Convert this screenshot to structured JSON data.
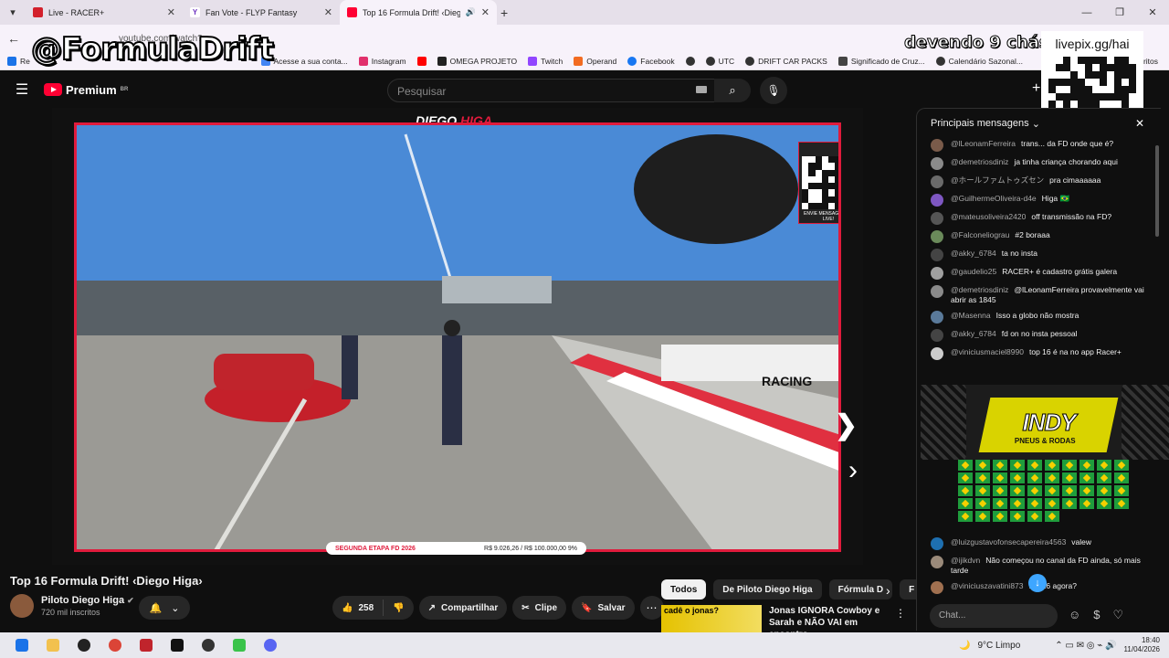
{
  "browser": {
    "tabs": [
      {
        "title": "Live - RACER+",
        "fav_color": "#d3202c",
        "active": false
      },
      {
        "title": "Fan Vote - FLYP Fantasy",
        "fav_color": "#6b2fbf",
        "active": false
      },
      {
        "title": "Top 16 Formula Drift! ‹Dieg",
        "fav_color": "#ff0033",
        "active": true
      }
    ],
    "url": "youtube.com/watch?v=...",
    "bookmarks": [
      {
        "label": "Re",
        "color": "#1a73e8"
      },
      {
        "label": "Acesse a sua conta...",
        "color": "#4285f4"
      },
      {
        "label": "Instagram",
        "color": "#e1306c"
      },
      {
        "label": "",
        "color": "#ff0000"
      },
      {
        "label": "OMEGA PROJETO",
        "color": "#222"
      },
      {
        "label": "Twitch",
        "color": "#9146ff"
      },
      {
        "label": "Operand",
        "color": "#f26b21"
      },
      {
        "label": "Facebook",
        "color": "#1877f2"
      },
      {
        "label": "",
        "color": "#333"
      },
      {
        "label": "UTC",
        "color": "#333"
      },
      {
        "label": "DRIFT CAR PACKS",
        "color": "#333"
      },
      {
        "label": "Significado de Cruz...",
        "color": "#444"
      },
      {
        "label": "Calendário Sazonal...",
        "color": "#333"
      },
      {
        "label": "ritos",
        "color": "#f7f2fa"
      }
    ]
  },
  "overlay": {
    "handle": "@FormulaDrift",
    "counter": "devendo 9 chás",
    "livepix": "livepix.gg/hai"
  },
  "youtube": {
    "logo": "Premium",
    "region": "BR",
    "search_placeholder": "Pesquisar",
    "video": {
      "driver_first": "DIEGO",
      "driver_last": "HIGA",
      "stage": "SEGUNDA ETAPA FD 2026",
      "goal": "R$ 9.026,26 / R$ 100.000,00",
      "goal_pct": "9%",
      "qr_caption": "ENVIE MENSAGEM NA LIVE!"
    },
    "title": "Top 16 Formula Drift! ‹Diego Higa›",
    "channel": "Piloto Diego Higa",
    "subscribers": "720 mil inscritos",
    "likes": "258",
    "share": "Compartilhar",
    "clip": "Clipe",
    "save": "Salvar",
    "chips": [
      "Todos",
      "De Piloto Diego Higa",
      "Fórmula D",
      "F"
    ],
    "rec": {
      "thumb_text": "cadê o jonas?",
      "title": "Jonas IGNORA Cowboy e Sarah e NÃO VAI em encontro"
    }
  },
  "chat": {
    "header": "Principais mensagens",
    "messages": [
      {
        "author": "@lLeonamFerreira",
        "text": "trans... da FD onde que é?",
        "color": "#7a5b4a"
      },
      {
        "author": "@demetriosdiniz",
        "text": "ja tinha criança chorando aqui",
        "color": "#8a8a8a"
      },
      {
        "author": "@ホールファムトゥズセン",
        "text": "pra cimaaaaaa",
        "color": "#6a6a6a"
      },
      {
        "author": "@GuilhermeOliveira-d4e",
        "text": "Higa 🇧🇷",
        "color": "#7e57c2"
      },
      {
        "author": "@mateusoliveira2420",
        "text": "off transmissão na FD?",
        "color": "#555"
      },
      {
        "author": "@Falconeliograu",
        "text": "#2  boraaa",
        "color": "#6a8a5a"
      },
      {
        "author": "@akky_6784",
        "text": "ta no insta",
        "color": "#444"
      },
      {
        "author": "@gaudelio25",
        "text": "RACER+ é cadastro grátis galera",
        "color": "#a0a0a0"
      },
      {
        "author": "@demetriosdiniz",
        "text": "@lLeonamFerreira provavelmente vai abrir as 1845",
        "color": "#8a8a8a"
      },
      {
        "author": "@Masenna",
        "text": "Isso a globo não mostra",
        "color": "#5a7a9a"
      },
      {
        "author": "@akky_6784",
        "text": "fd on no insta pessoal",
        "color": "#444"
      },
      {
        "author": "@viniciusmaciel8990",
        "text": "top 16 é na no app Racer+",
        "color": "#ccc"
      }
    ],
    "sponsor": {
      "brand": "INDY",
      "sub": "PNEUS & RODAS"
    },
    "flag_count": 46,
    "messages2": [
      {
        "author": "@luizgustavofonsecapereira4563",
        "text": "valew",
        "color": "#1e6fb0"
      },
      {
        "author": "@ijikdvn",
        "text": "Não começou no canal da FD ainda, só mais tarde",
        "color": "#9a8a7a"
      },
      {
        "author": "@viniciuszavatini873",
        "text": "...p 16 agora?",
        "color": "#a07050"
      }
    ],
    "input_placeholder": "Chat..."
  },
  "taskbar": {
    "weather": "9°C  Limpo",
    "time": "18:40",
    "date": "11/04/2026"
  }
}
